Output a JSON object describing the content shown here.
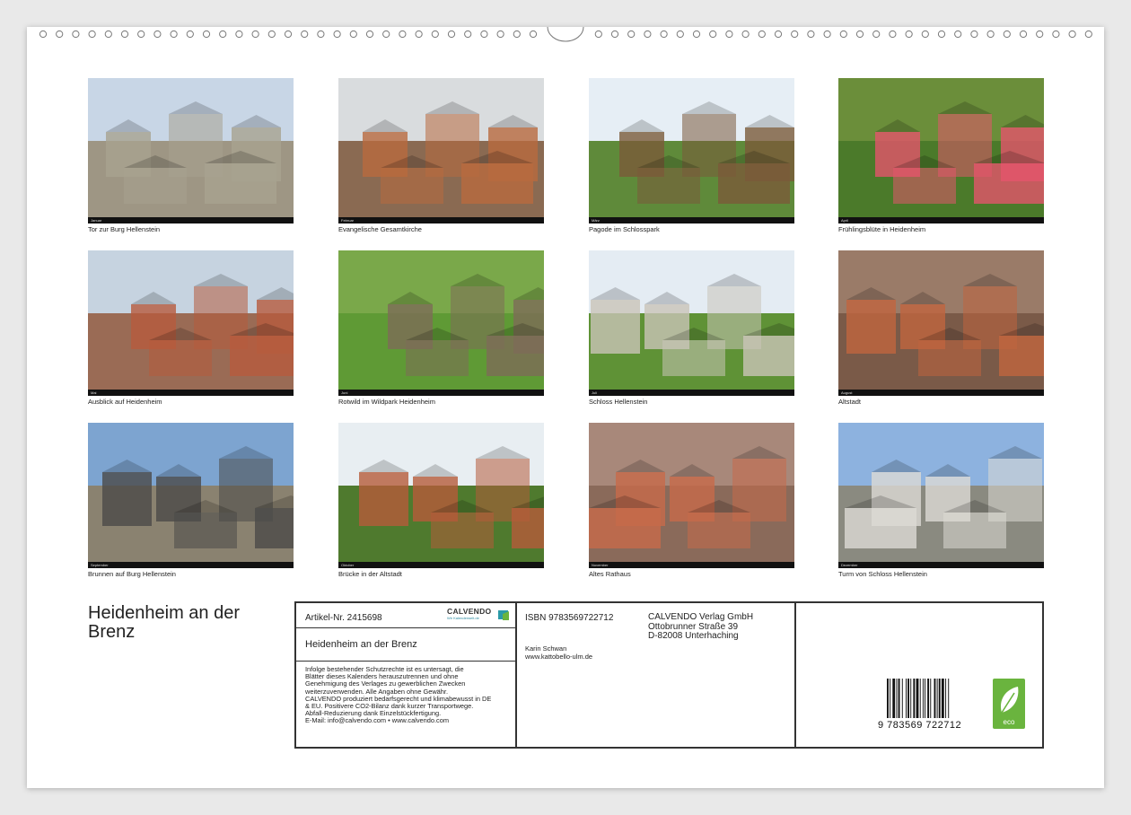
{
  "calendar": {
    "title": "Heidenheim an der Brenz",
    "months": [
      {
        "bar": "Januar",
        "caption": "Tor zur Burg Hellenstein",
        "sky": "#c8d6e6",
        "ground": "#9e9684",
        "accent": "#a7a290"
      },
      {
        "bar": "Februar",
        "caption": "Evangelische Gesamtkirche",
        "sky": "#d9dcde",
        "ground": "#8a6a52",
        "accent": "#b86a3e"
      },
      {
        "bar": "März",
        "caption": "Pagode im Schlosspark",
        "sky": "#e6eef5",
        "ground": "#5f8a3a",
        "accent": "#7a5a3a"
      },
      {
        "bar": "April",
        "caption": "Frühlingsblüte in Heidenheim",
        "sky": "#6b8e3a",
        "ground": "#4b7a2a",
        "accent": "#e4556b"
      },
      {
        "bar": "Mai",
        "caption": "Ausblick auf Heidenheim",
        "sky": "#c6d3e0",
        "ground": "#9a6b55",
        "accent": "#b75b3d"
      },
      {
        "bar": "Juni",
        "caption": "Rotwild im Wildpark Heidenheim",
        "sky": "#7aa84a",
        "ground": "#5f9a35",
        "accent": "#7d6b57"
      },
      {
        "bar": "Juli",
        "caption": "Schloss Hellenstein",
        "sky": "#e4ecf3",
        "ground": "#5f9236",
        "accent": "#c9c4b8"
      },
      {
        "bar": "August",
        "caption": "Altstadt",
        "sky": "#9a7b68",
        "ground": "#7a5a48",
        "accent": "#c0653e"
      },
      {
        "bar": "September",
        "caption": "Brunnen auf Burg Hellenstein",
        "sky": "#7da4d0",
        "ground": "#8a8270",
        "accent": "#4b4a48"
      },
      {
        "bar": "Oktober",
        "caption": "Brücke in der Altstadt",
        "sky": "#e8eef2",
        "ground": "#4f7a2e",
        "accent": "#b55b3a"
      },
      {
        "bar": "November",
        "caption": "Altes Rathaus",
        "sky": "#a8887a",
        "ground": "#8a6a5a",
        "accent": "#c76a4a"
      },
      {
        "bar": "Dezember",
        "caption": "Turm von Schloss Hellenstein",
        "sky": "#8db2df",
        "ground": "#8a8a80",
        "accent": "#dcdad4"
      }
    ]
  },
  "info": {
    "article_no": "Artikel-Nr. 2415698",
    "logo_word": "CALVENDO",
    "logo_sub": "Wir Kalenderwelt.de",
    "box_title": "Heidenheim an der Brenz",
    "legal_lines": [
      "Infolge bestehender Schutzrechte ist es untersagt, die",
      "Blätter dieses Kalenders herauszutrennen und ohne",
      "Genehmigung des Verlages zu gewerblichen Zwecken",
      "weiterzuverwenden. Alle Angaben ohne Gewähr.",
      "CALVENDO produziert bedarfsgerecht und klimabewusst in DE",
      "& EU. Positivere CO2-Bilanz dank kurzer Transportwege.",
      "Abfall-Reduzierung dank Einzelstückfertigung.",
      "E-Mail: info@calvendo.com • www.calvendo.com"
    ],
    "isbn": "ISBN 9783569722712",
    "author": "Karin Schwan",
    "author_url": "www.kattobello-ulm.de",
    "publisher": [
      "CALVENDO Verlag GmbH",
      "Ottobrunner Straße 39",
      "D-82008 Unterhaching"
    ],
    "barcode_number": "9 783569 722712",
    "eco_label": "eco"
  }
}
